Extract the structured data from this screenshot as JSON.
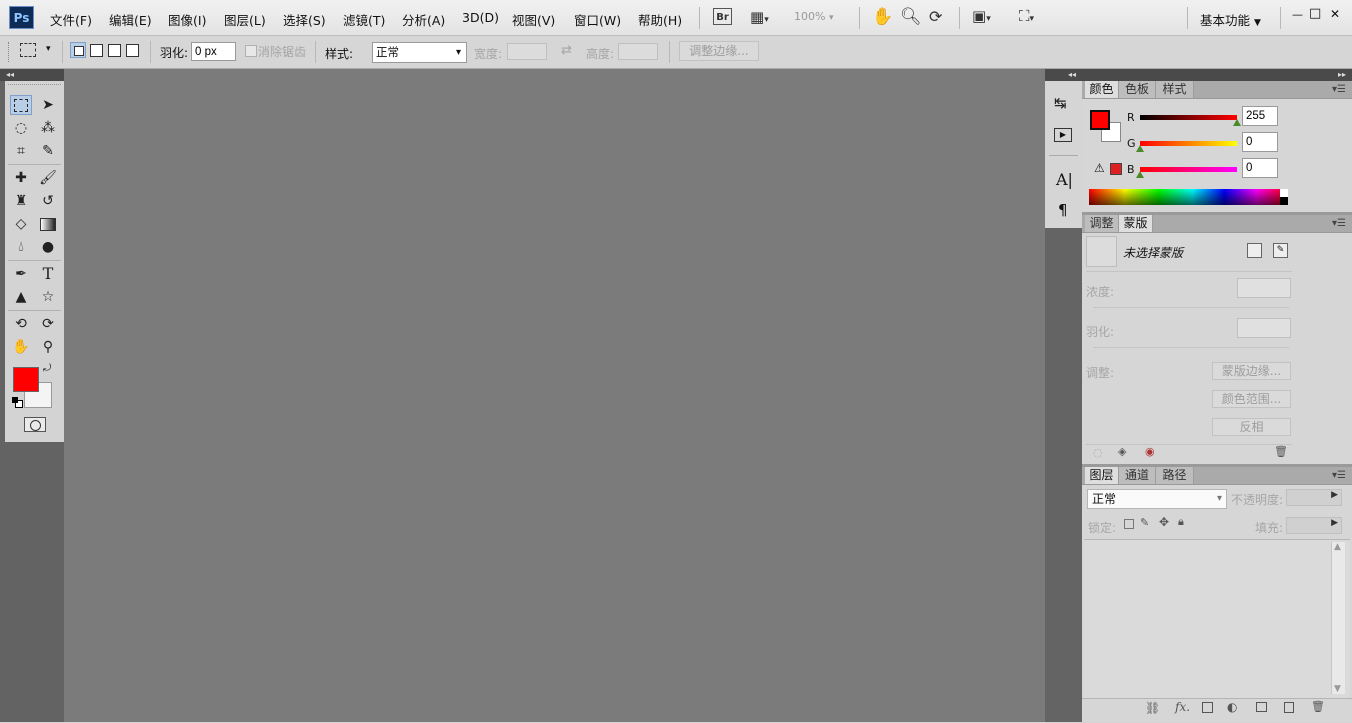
{
  "app": {
    "logo": "Ps"
  },
  "menubar": {
    "items": [
      "文件(F)",
      "编辑(E)",
      "图像(I)",
      "图层(L)",
      "选择(S)",
      "滤镜(T)",
      "分析(A)",
      "3D(D)",
      "视图(V)",
      "窗口(W)",
      "帮助(H)"
    ],
    "br_label": "Br",
    "zoom": "100%",
    "workspace": "基本功能",
    "window_buttons": [
      "—",
      "□",
      "✕"
    ]
  },
  "options": {
    "feather_label": "羽化:",
    "feather_value": "0 px",
    "antialias_label": "消除锯齿",
    "style_label": "样式:",
    "style_value": "正常",
    "width_label": "宽度:",
    "height_label": "高度:",
    "refine_edge": "调整边缘..."
  },
  "color_panel": {
    "tabs": [
      "颜色",
      "色板",
      "样式"
    ],
    "channels": [
      {
        "name": "R",
        "value": "255",
        "fraction": 1.0
      },
      {
        "name": "G",
        "value": "0",
        "fraction": 0.0
      },
      {
        "name": "B",
        "value": "0",
        "fraction": 0.0
      }
    ],
    "foreground": "#ff0000",
    "background": "#ffffff"
  },
  "masks_panel": {
    "tabs": [
      "调整",
      "蒙版"
    ],
    "status": "未选择蒙版",
    "density_label": "浓度:",
    "feather_label": "羽化:",
    "refine_label": "调整:",
    "btn_mask_edge": "蒙版边缘...",
    "btn_color_range": "颜色范围...",
    "btn_invert": "反相"
  },
  "layers_panel": {
    "tabs": [
      "图层",
      "通道",
      "路径"
    ],
    "blend_mode": "正常",
    "opacity_label": "不透明度:",
    "lock_label": "锁定:",
    "fill_label": "填充:"
  }
}
